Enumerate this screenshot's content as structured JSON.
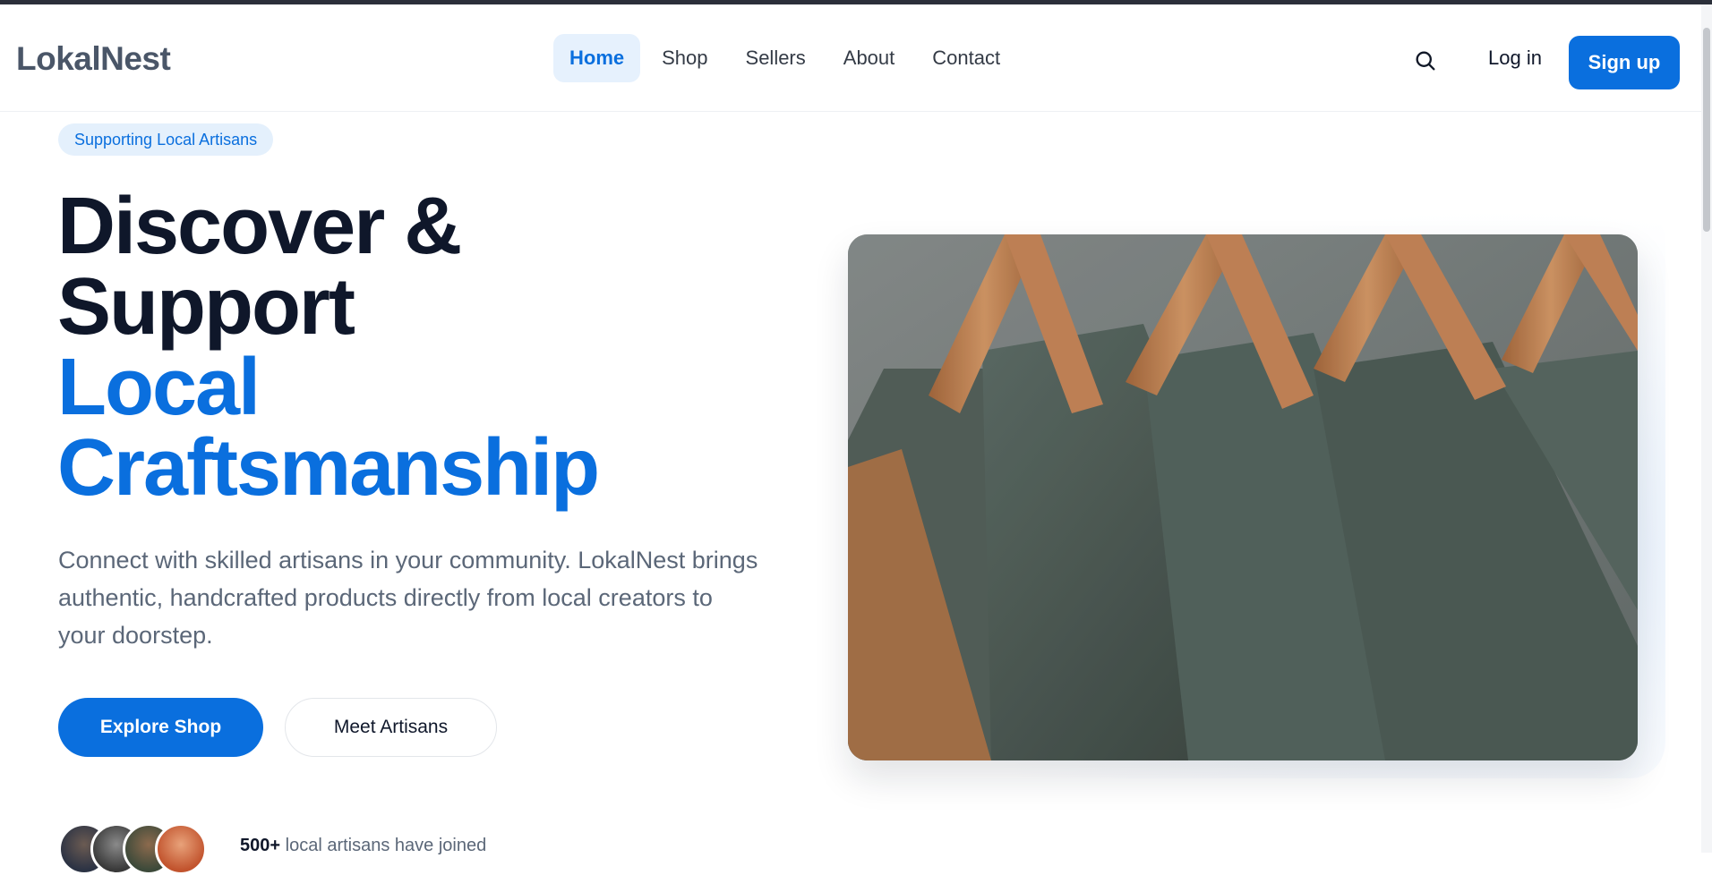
{
  "brand": {
    "name": "LokalNest",
    "accent": "#0a6fde"
  },
  "nav": {
    "items": [
      {
        "label": "Home",
        "active": true
      },
      {
        "label": "Shop",
        "active": false
      },
      {
        "label": "Sellers",
        "active": false
      },
      {
        "label": "About",
        "active": false
      },
      {
        "label": "Contact",
        "active": false
      }
    ],
    "search_icon": "search-icon",
    "login_label": "Log in",
    "signup_label": "Sign up"
  },
  "hero": {
    "badge": "Supporting Local Artisans",
    "headline_line1": "Discover &",
    "headline_line2": "Support",
    "headline_line3": "Local",
    "headline_line4": "Craftsmanship",
    "lead": "Connect with skilled artisans in your community. LokalNest brings authentic, handcrafted products directly from local creators to your doorstep.",
    "primary_cta": "Explore Shop",
    "secondary_cta": "Meet Artisans",
    "social_count": "500+",
    "social_text": "local artisans have joined"
  }
}
